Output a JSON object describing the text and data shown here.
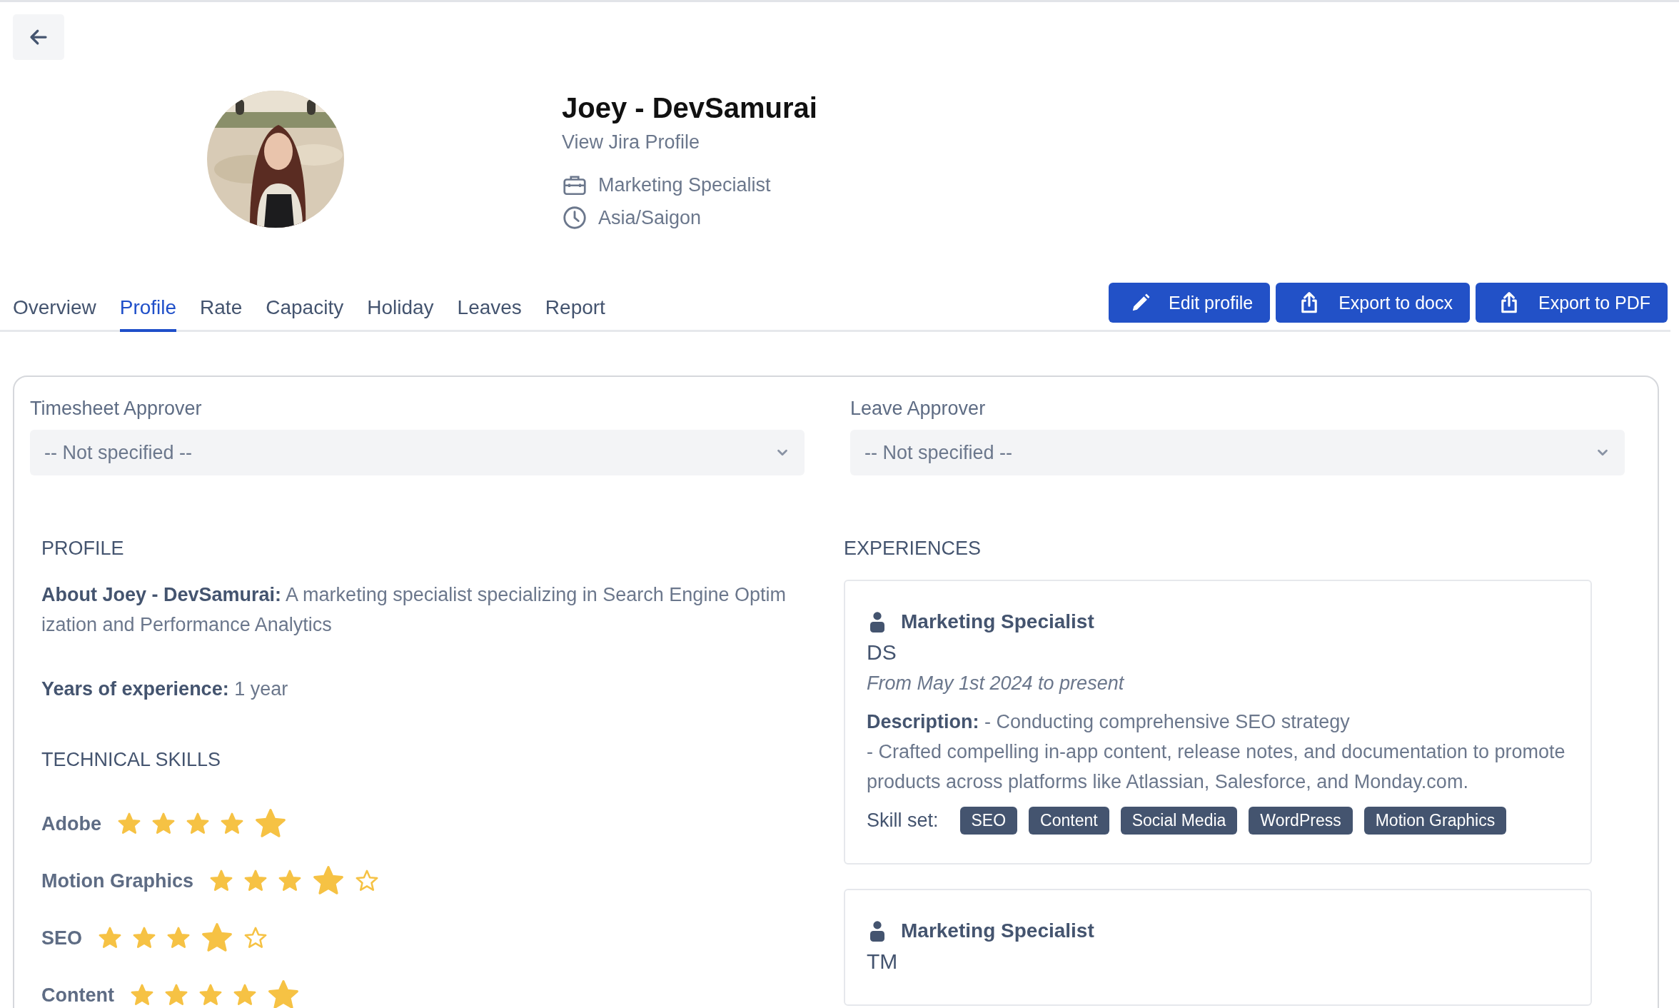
{
  "profile": {
    "name": "Joey - DevSamurai",
    "link": "View Jira Profile",
    "details": [
      {
        "kind": "job",
        "text": "Marketing Specialist"
      },
      {
        "kind": "timezone",
        "text": "Asia/Saigon"
      }
    ]
  },
  "tabs": [
    {
      "label": "Overview",
      "selected": false
    },
    {
      "label": "Profile",
      "selected": true
    },
    {
      "label": "Rate",
      "selected": false
    },
    {
      "label": "Capacity",
      "selected": false
    },
    {
      "label": "Holiday",
      "selected": false
    },
    {
      "label": "Leaves",
      "selected": false
    },
    {
      "label": "Report",
      "selected": false
    }
  ],
  "actions": [
    {
      "kind": "edit",
      "label": "Edit profile"
    },
    {
      "kind": "export",
      "label": "Export to docx"
    },
    {
      "kind": "export",
      "label": "Export to PDF"
    }
  ],
  "approvers": [
    {
      "label": "Timesheet Approver",
      "placeholder": "-- Not specified --"
    },
    {
      "label": "Leave Approver",
      "placeholder": "-- Not specified --"
    }
  ],
  "profile_section": {
    "heading": "PROFILE",
    "about": "**About Joey - DevSamurai:** A marketing specialist specializing in Search Engine Optimization and Performance Analytics",
    "experience_years": "**Years of experience:** 1 year"
  },
  "skills": {
    "heading": "TECHNICAL SKILLS",
    "items": [
      {
        "name": "Adobe",
        "stars": 5
      },
      {
        "name": "Motion Graphics",
        "stars": 4
      },
      {
        "name": "SEO",
        "stars": 4
      },
      {
        "name": "Content",
        "stars": 5
      }
    ]
  },
  "experiences": {
    "heading": "EXPERIENCES",
    "items": [
      {
        "title": "Marketing Specialist",
        "company": "DS",
        "period": "From May 1st 2024 to present",
        "description": "**Description:** - Conducting comprehensive SEO strategy\n- Crafted compelling in-app content, release notes, and documentation to promote products across platforms like Atlassian, Salesforce, and Monday.com.",
        "skill_label": "Skill set:",
        "skills": [
          "SEO",
          "Content",
          "Social Media",
          "WordPress",
          "Motion Graphics"
        ]
      },
      {
        "title": "Marketing Specialist",
        "company": "TM"
      }
    ]
  }
}
